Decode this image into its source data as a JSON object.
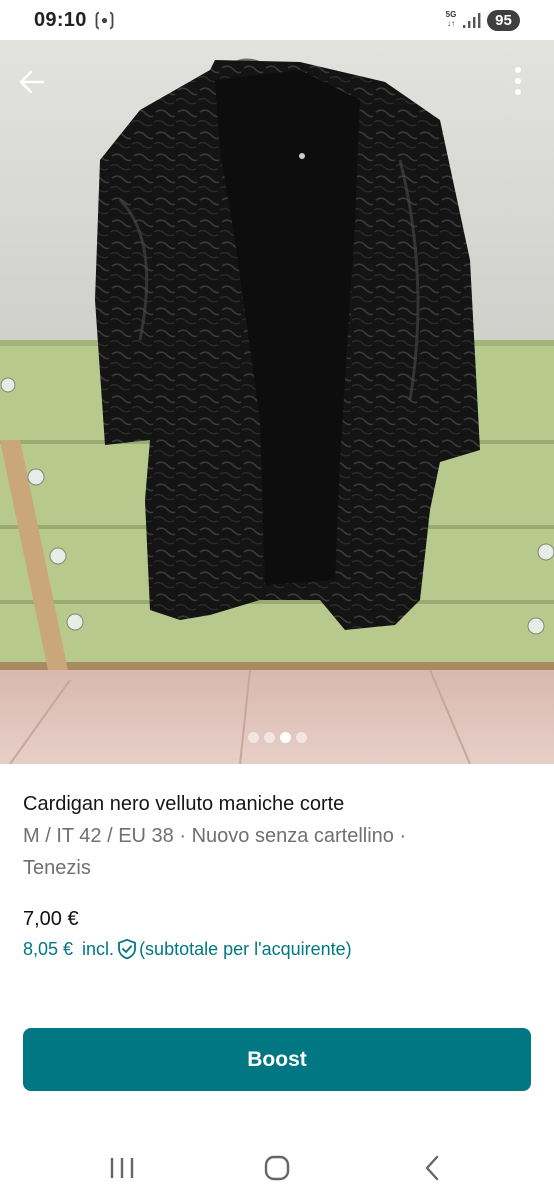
{
  "status_bar": {
    "time": "09:10",
    "network_top": "5G",
    "network_bottom": "↓↑",
    "battery": "95",
    "icons": [
      "screen-record-icon",
      "signal-icon"
    ]
  },
  "photo": {
    "description_icon_back": "back-arrow-icon",
    "description_icon_menu": "more-vert-icon",
    "pager": {
      "total": 4,
      "active_index": 2
    }
  },
  "item": {
    "title": "Cardigan nero velluto  maniche corte",
    "meta": "M / IT 42 / EU 38 · Nuovo senza cartellino ·",
    "brand": "Tenezis",
    "price": "7,00 €",
    "buyer_price": "8,05 €",
    "buyer_price_incl": "incl.",
    "buyer_price_note": "(subtotale per l'acquirente)"
  },
  "actions": {
    "boost_label": "Boost"
  },
  "colors": {
    "accent": "#007782",
    "text_primary": "#161616",
    "text_secondary": "#707070"
  },
  "nav_bar": {
    "icons": [
      "recent-apps-icon",
      "home-icon",
      "back-icon"
    ]
  }
}
